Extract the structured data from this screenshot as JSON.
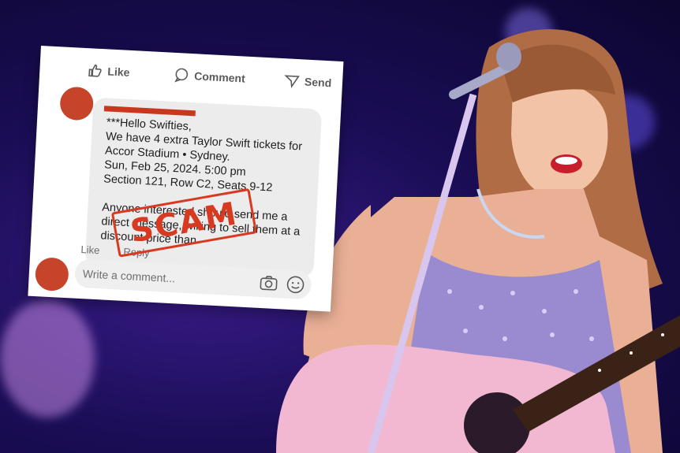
{
  "post": {
    "actions": [
      {
        "label": "Like",
        "icon": "thumbs-up-icon"
      },
      {
        "label": "Comment",
        "icon": "comment-bubble-icon"
      },
      {
        "label": "Send",
        "icon": "send-arrow-icon"
      }
    ],
    "message_lines": [
      "***Hello Swifties,",
      "We have 4 extra Taylor Swift tickets for",
      "Accor Stadium • Sydney.",
      "Sun, Feb 25, 2024. 5:00 pm",
      "Section 121, Row C2, Seats 9-12",
      "",
      "Anyone interested should send me a",
      "direct message, willing to sell them at a",
      "discount price than"
    ],
    "like_label": "Like",
    "reply_label": "Reply",
    "comment_placeholder": "Write a comment...",
    "stamp_text": "SCAM"
  },
  "colors": {
    "avatar": "#c6442a",
    "stamp": "#d73a20",
    "redaction": "#c9371f",
    "background": "#1a0d55"
  }
}
